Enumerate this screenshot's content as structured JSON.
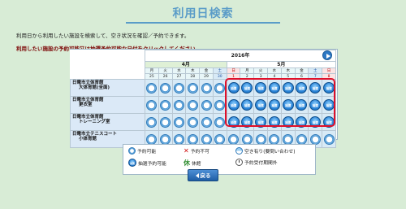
{
  "page": {
    "title": "利用日検索",
    "message1": "利用日から利用したい施設を検索して、空き状況を確認／予約できます。",
    "message2": "利用したい施設の予約可能又は抽選予約可能な日付をクリックしてください。"
  },
  "calendar": {
    "year_label": "2016年",
    "months": [
      {
        "label": "4月",
        "span": 6
      },
      {
        "label": "5月",
        "span": 8
      }
    ],
    "days": [
      {
        "dow": "月",
        "day": "25",
        "type": "weekday"
      },
      {
        "dow": "火",
        "day": "26",
        "type": "weekday"
      },
      {
        "dow": "水",
        "day": "27",
        "type": "weekday"
      },
      {
        "dow": "木",
        "day": "28",
        "type": "weekday"
      },
      {
        "dow": "金",
        "day": "29",
        "type": "weekday"
      },
      {
        "dow": "土",
        "day": "30",
        "type": "sat"
      },
      {
        "dow": "日",
        "day": "1",
        "type": "sun"
      },
      {
        "dow": "月",
        "day": "2",
        "type": "weekday"
      },
      {
        "dow": "火",
        "day": "3",
        "type": "weekday"
      },
      {
        "dow": "水",
        "day": "4",
        "type": "weekday"
      },
      {
        "dow": "木",
        "day": "5",
        "type": "weekday"
      },
      {
        "dow": "金",
        "day": "6",
        "type": "weekday"
      },
      {
        "dow": "土",
        "day": "7",
        "type": "sat"
      },
      {
        "dow": "日",
        "day": "8",
        "type": "sun"
      }
    ],
    "facilities": [
      {
        "lines": [
          "日電市立体育館",
          "大体育館(全面)"
        ],
        "cells": [
          "avail",
          "avail",
          "avail",
          "avail",
          "avail",
          "avail",
          "lottery",
          "lottery",
          "lottery",
          "lottery",
          "lottery",
          "lottery",
          "lottery",
          "lottery"
        ]
      },
      {
        "lines": [
          "日電市立体育館",
          "更衣室"
        ],
        "cells": [
          "avail",
          "avail",
          "avail",
          "avail",
          "avail",
          "avail",
          "lottery",
          "lottery",
          "lottery",
          "lottery",
          "lottery",
          "lottery",
          "lottery",
          "lottery"
        ]
      },
      {
        "lines": [
          "日電市立体育館",
          "トレーニング室"
        ],
        "cells": [
          "avail",
          "avail",
          "avail",
          "avail",
          "avail",
          "avail",
          "lottery",
          "lottery",
          "lottery",
          "lottery",
          "lottery",
          "lottery",
          "lottery",
          "lottery"
        ]
      },
      {
        "lines": [
          "日電市立テニスコート",
          "小体育館"
        ],
        "cells": [
          "avail",
          "avail",
          "avail",
          "avail",
          "avail",
          "avail",
          "avail",
          "avail",
          "avail",
          "avail",
          "avail",
          "avail",
          "avail",
          "avail"
        ]
      }
    ],
    "lottery_label": "抽選",
    "accent_color": "#e0102a"
  },
  "legend": {
    "available": "予約可能",
    "unavailable": "予約不可",
    "partial": "空き有り(要問い合わせ)",
    "lottery": "抽選予約可能",
    "closed": "休館",
    "out_of_period": "予約受付期間外",
    "lottery_icon_label": "抽選",
    "closed_icon_label": "休"
  },
  "buttons": {
    "back": "戻る"
  }
}
